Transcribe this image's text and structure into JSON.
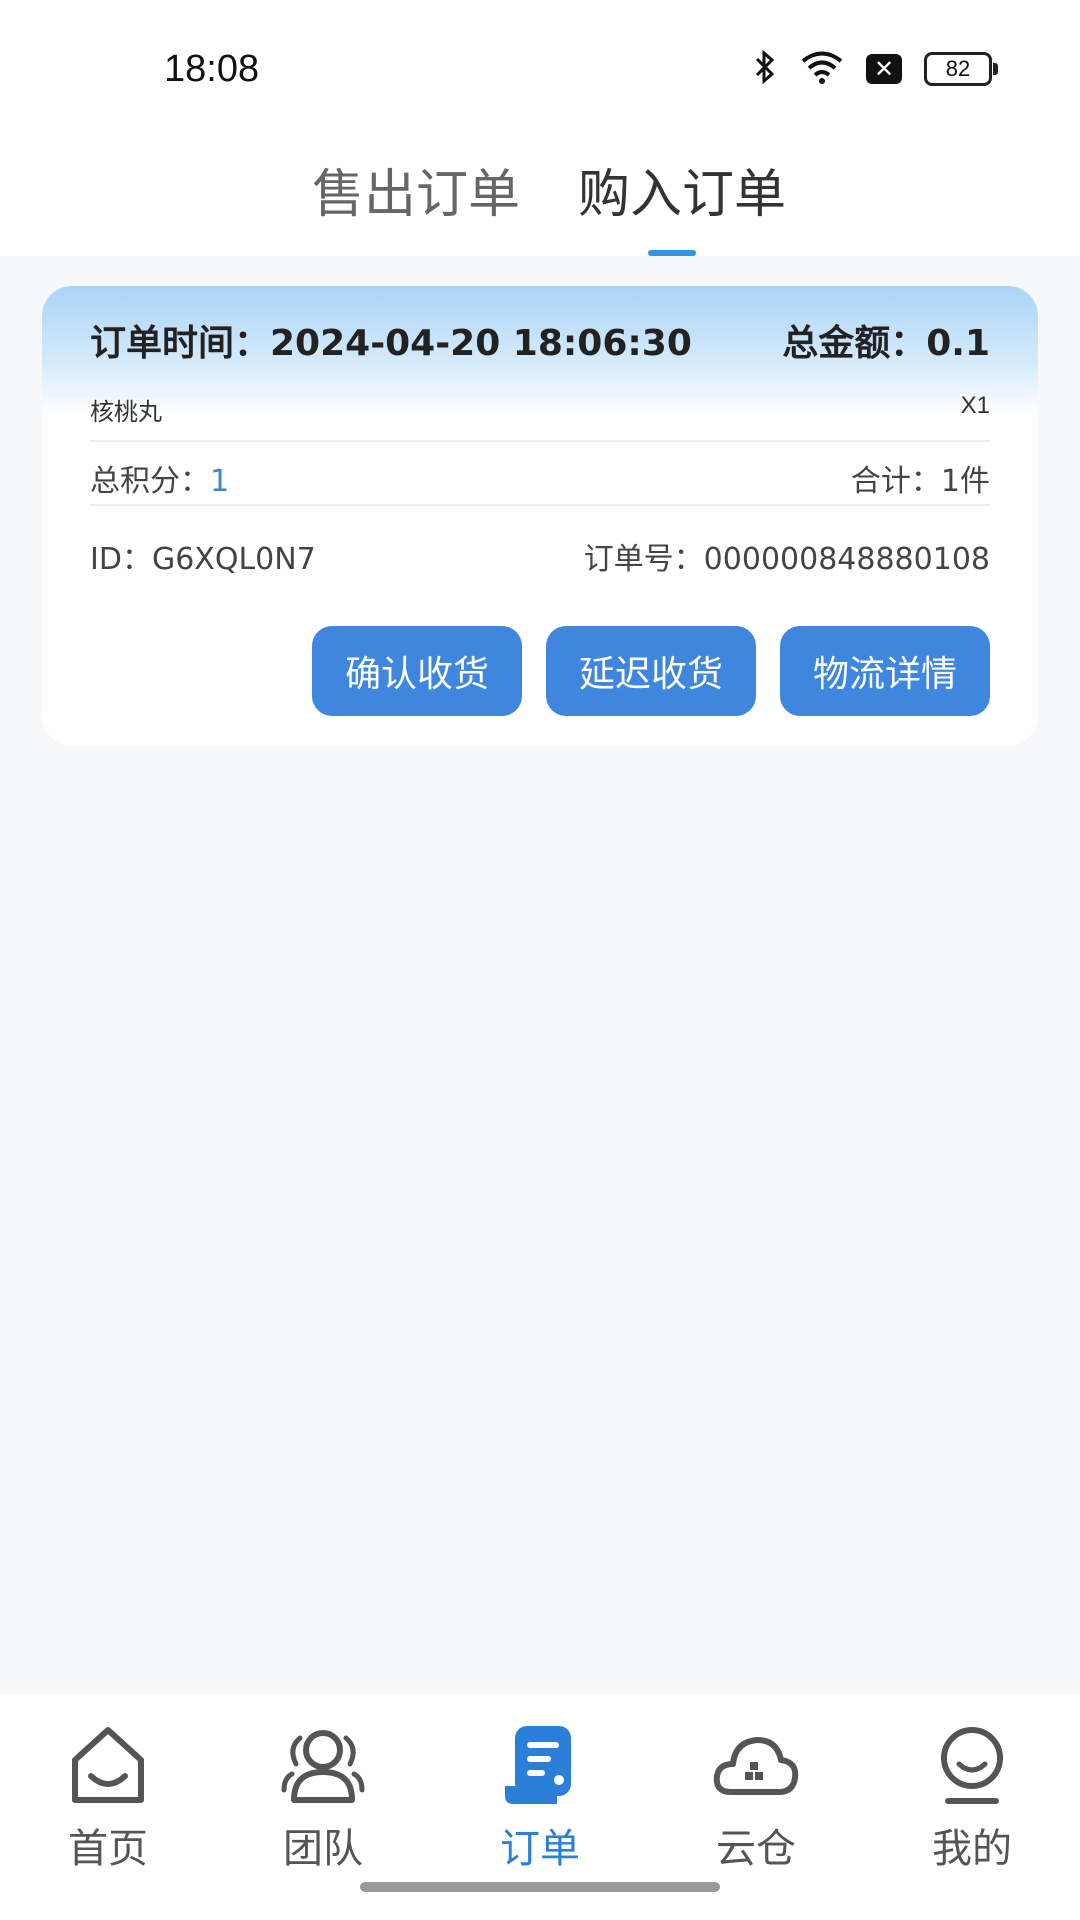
{
  "status_bar": {
    "time": "18:08",
    "battery": "82",
    "icons": [
      "bluetooth-icon",
      "wifi-icon",
      "notification-x-icon",
      "battery-icon"
    ]
  },
  "tabs": [
    {
      "label": "售出订单",
      "active": false
    },
    {
      "label": "购入订单",
      "active": true
    }
  ],
  "order": {
    "time_label": "订单时间：2024-04-20 18:06:30",
    "amount_label": "总金额：0.1",
    "product_name": "核桃丸",
    "quantity": "X1",
    "points_label": "总积分：",
    "points_value": "1",
    "total_count": "合计：1件",
    "id_text": "ID：G6XQL0N7",
    "order_no": "订单号：000000848880108",
    "buttons": {
      "confirm": "确认收货",
      "delay": "延迟收货",
      "logistics": "物流详情"
    }
  },
  "bottom_nav": [
    {
      "label": "首页",
      "icon": "home-icon",
      "active": false
    },
    {
      "label": "团队",
      "icon": "team-icon",
      "active": false
    },
    {
      "label": "订单",
      "icon": "order-icon",
      "active": true
    },
    {
      "label": "云仓",
      "icon": "cloud-warehouse-icon",
      "active": false
    },
    {
      "label": "我的",
      "icon": "profile-icon",
      "active": false
    }
  ],
  "colors": {
    "accent": "#3f86de",
    "nav_active": "#2b7fd6",
    "tab_indicator": "#2c9ae8",
    "background": "#f7f8fa"
  }
}
